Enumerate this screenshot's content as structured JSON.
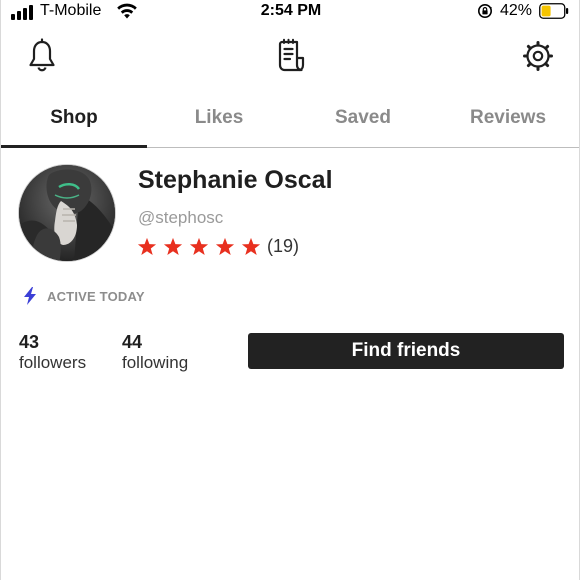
{
  "status_bar": {
    "carrier": "T-Mobile",
    "time": "2:54 PM",
    "battery_percent": "42%",
    "battery_level": 0.42,
    "battery_color": "#f5c400"
  },
  "top_icons": [
    "bell-icon",
    "receipt-icon",
    "gear-icon"
  ],
  "tabs": [
    {
      "label": "Shop",
      "active": true
    },
    {
      "label": "Likes",
      "active": false
    },
    {
      "label": "Saved",
      "active": false
    },
    {
      "label": "Reviews",
      "active": false
    }
  ],
  "profile": {
    "name": "Stephanie Oscal",
    "handle": "@stephosc",
    "rating_stars": 5,
    "review_count": "(19)",
    "star_color": "#e8301f",
    "activity": "ACTIVE TODAY",
    "activity_icon_color": "#3b3fd6"
  },
  "stats": {
    "followers_count": "43",
    "followers_label": "followers",
    "following_count": "44",
    "following_label": "following"
  },
  "actions": {
    "find_friends_label": "Find friends"
  }
}
